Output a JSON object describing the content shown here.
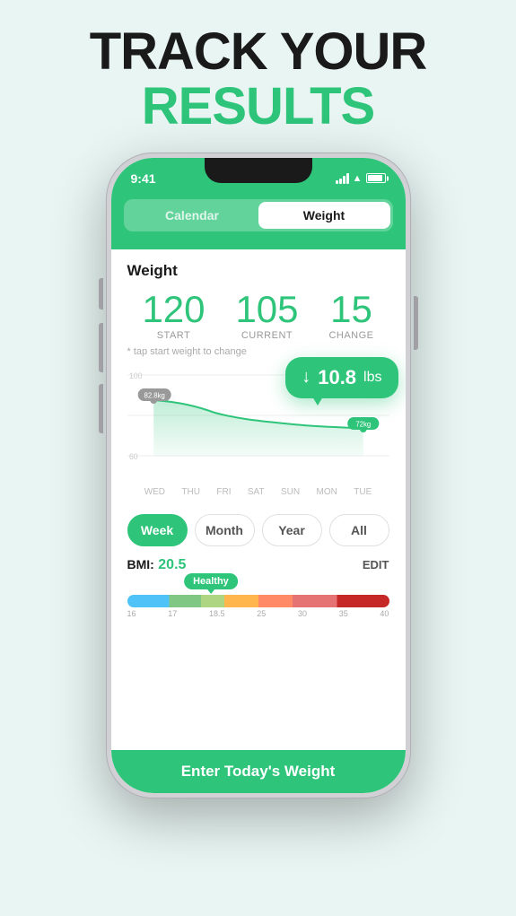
{
  "header": {
    "line1": "TRACK YOUR",
    "line2": "RESULTS"
  },
  "phone": {
    "status_bar": {
      "time": "9:41"
    },
    "tabs": [
      {
        "label": "Calendar",
        "active": false
      },
      {
        "label": "Weight",
        "active": true
      }
    ],
    "weight_section": {
      "title": "Weight",
      "stats": [
        {
          "value": "120",
          "label": "START"
        },
        {
          "value": "105",
          "label": "CURRENT"
        },
        {
          "value": "15",
          "label": "CHANGE"
        }
      ],
      "tap_hint": "* tap start weight to change",
      "tooltip": {
        "value": "10.8",
        "unit": "lbs"
      },
      "chart": {
        "y_start": "82.8kg",
        "y_end": "72kg",
        "y_min": "60",
        "y_max": "100",
        "days": [
          "WED",
          "THU",
          "FRI",
          "SAT",
          "SUN",
          "MON",
          "TUE"
        ]
      },
      "periods": [
        {
          "label": "Week",
          "active": true
        },
        {
          "label": "Month",
          "active": false
        },
        {
          "label": "Year",
          "active": false
        },
        {
          "label": "All",
          "active": false
        }
      ],
      "bmi": {
        "label": "BMI:",
        "value": "20.5",
        "edit": "EDIT",
        "status": "Healthy",
        "ticks": [
          "16",
          "17",
          "18.5",
          "25",
          "30",
          "35",
          "40"
        ]
      },
      "enter_weight_btn": "Enter Today's Weight"
    }
  }
}
